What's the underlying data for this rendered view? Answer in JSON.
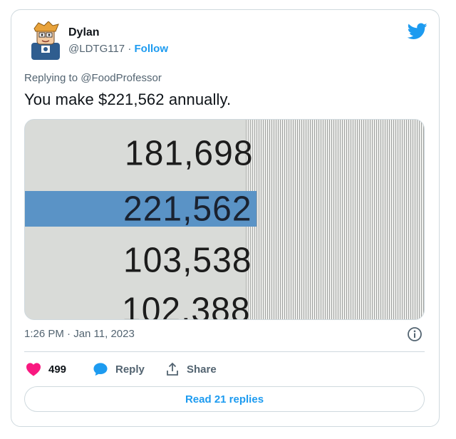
{
  "author": {
    "name": "Dylan",
    "handle": "@LDTG117",
    "separator": "·",
    "follow_label": "Follow"
  },
  "reply_context": {
    "prefix": "Replying to",
    "mention": "@FoodProfessor"
  },
  "tweet": {
    "text": "You make $221,562 annually.",
    "timestamp": "1:26 PM · Jan 11, 2023"
  },
  "photo": {
    "numbers": [
      "181,698",
      "221,562",
      "103,538",
      "102,388"
    ],
    "highlighted_index": 1
  },
  "actions": {
    "likes": "499",
    "reply_label": "Reply",
    "share_label": "Share"
  },
  "read_replies_label": "Read 21 replies",
  "colors": {
    "accent": "#1d9bf0",
    "like": "#f91880",
    "muted": "#536471",
    "border": "#cfd9de"
  },
  "icons": [
    "avatar",
    "twitter-bird-icon",
    "info-icon",
    "heart-icon",
    "reply-bubble-icon",
    "share-icon"
  ]
}
